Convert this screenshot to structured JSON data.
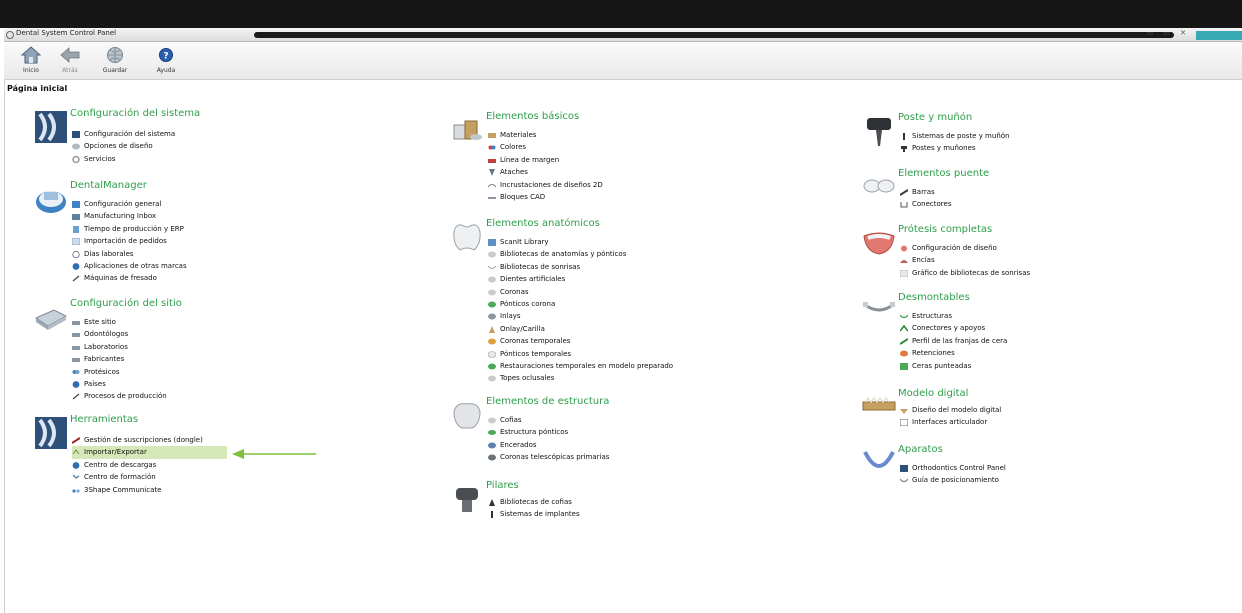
{
  "window": {
    "title": "Dental System Control Panel",
    "controls": "▭ ▭ ✕"
  },
  "toolbar": {
    "home": "Inicio",
    "back": "Atrás",
    "save": "Guardar",
    "help": "Ayuda"
  },
  "page": {
    "title": "Página inicial"
  },
  "sections": {
    "config_sistema": {
      "title": "Configuración del sistema",
      "items": [
        "Configuración del sistema",
        "Opciones de diseño",
        "Servicios"
      ]
    },
    "dental_manager": {
      "title": "DentalManager",
      "items": [
        "Configuración general",
        "Manufacturing Inbox",
        "Tiempo de producción y ERP",
        "Importación de pedidos",
        "Días laborales",
        "Aplicaciones de otras marcas",
        "Máquinas de fresado"
      ]
    },
    "config_sitio": {
      "title": "Configuración del sitio",
      "items": [
        "Este sitio",
        "Odontólogos",
        "Laboratorios",
        "Fabricantes",
        "Protésicos",
        "Países",
        "Procesos de producción"
      ]
    },
    "herramientas": {
      "title": "Herramientas",
      "items": [
        "Gestión de suscripciones (dongle)",
        "Importar/Exportar",
        "Centro de descargas",
        "Centro de formación",
        "3Shape Communicate"
      ]
    },
    "elementos_basicos": {
      "title": "Elementos básicos",
      "items": [
        "Materiales",
        "Colores",
        "Línea de margen",
        "Ataches",
        "Incrustaciones de diseños 2D",
        "Bloques CAD"
      ]
    },
    "elementos_anatomicos": {
      "title": "Elementos anatómicos",
      "items": [
        "ScanIt Library",
        "Bibliotecas de anatomías y pónticos",
        "Bibliotecas de sonrisas",
        "Dientes artificiales",
        "Coronas",
        "Pónticos corona",
        "Inlays",
        "Onlay/Carilla",
        "Coronas temporales",
        "Pónticos temporales",
        "Restauraciones temporales en modelo preparado",
        "Topes oclusales"
      ]
    },
    "elementos_estructura": {
      "title": "Elementos de estructura",
      "items": [
        "Cofias",
        "Estructura pónticos",
        "Encerados",
        "Coronas telescópicas primarias"
      ]
    },
    "pilares": {
      "title": "Pilares",
      "items": [
        "Bibliotecas de cofias",
        "Sistemas de implantes"
      ]
    },
    "poste_munon": {
      "title": "Poste y muñón",
      "items": [
        "Sistemas de poste y muñón",
        "Postes y muñones"
      ]
    },
    "elementos_puente": {
      "title": "Elementos puente",
      "items": [
        "Barras",
        "Conectores"
      ]
    },
    "protesis_completas": {
      "title": "Prótesis completas",
      "items": [
        "Configuración de diseño",
        "Encías",
        "Gráfico de bibliotecas de sonrisas"
      ]
    },
    "desmontables": {
      "title": "Desmontables",
      "items": [
        "Estructuras",
        "Conectores y apoyos",
        "Perfil de las franjas de cera",
        "Retenciones",
        "Ceras punteadas"
      ]
    },
    "modelo_digital": {
      "title": "Modelo digital",
      "items": [
        "Diseño del modelo digital",
        "Interfaces articulador"
      ]
    },
    "aparatos": {
      "title": "Aparatos",
      "items": [
        "Orthodontics Control Panel",
        "Guía de posicionamiento"
      ]
    }
  },
  "colors": {
    "section_title": "#2e9e4a",
    "highlight": "#d6e8b8",
    "arrow": "#7fbf3f"
  }
}
